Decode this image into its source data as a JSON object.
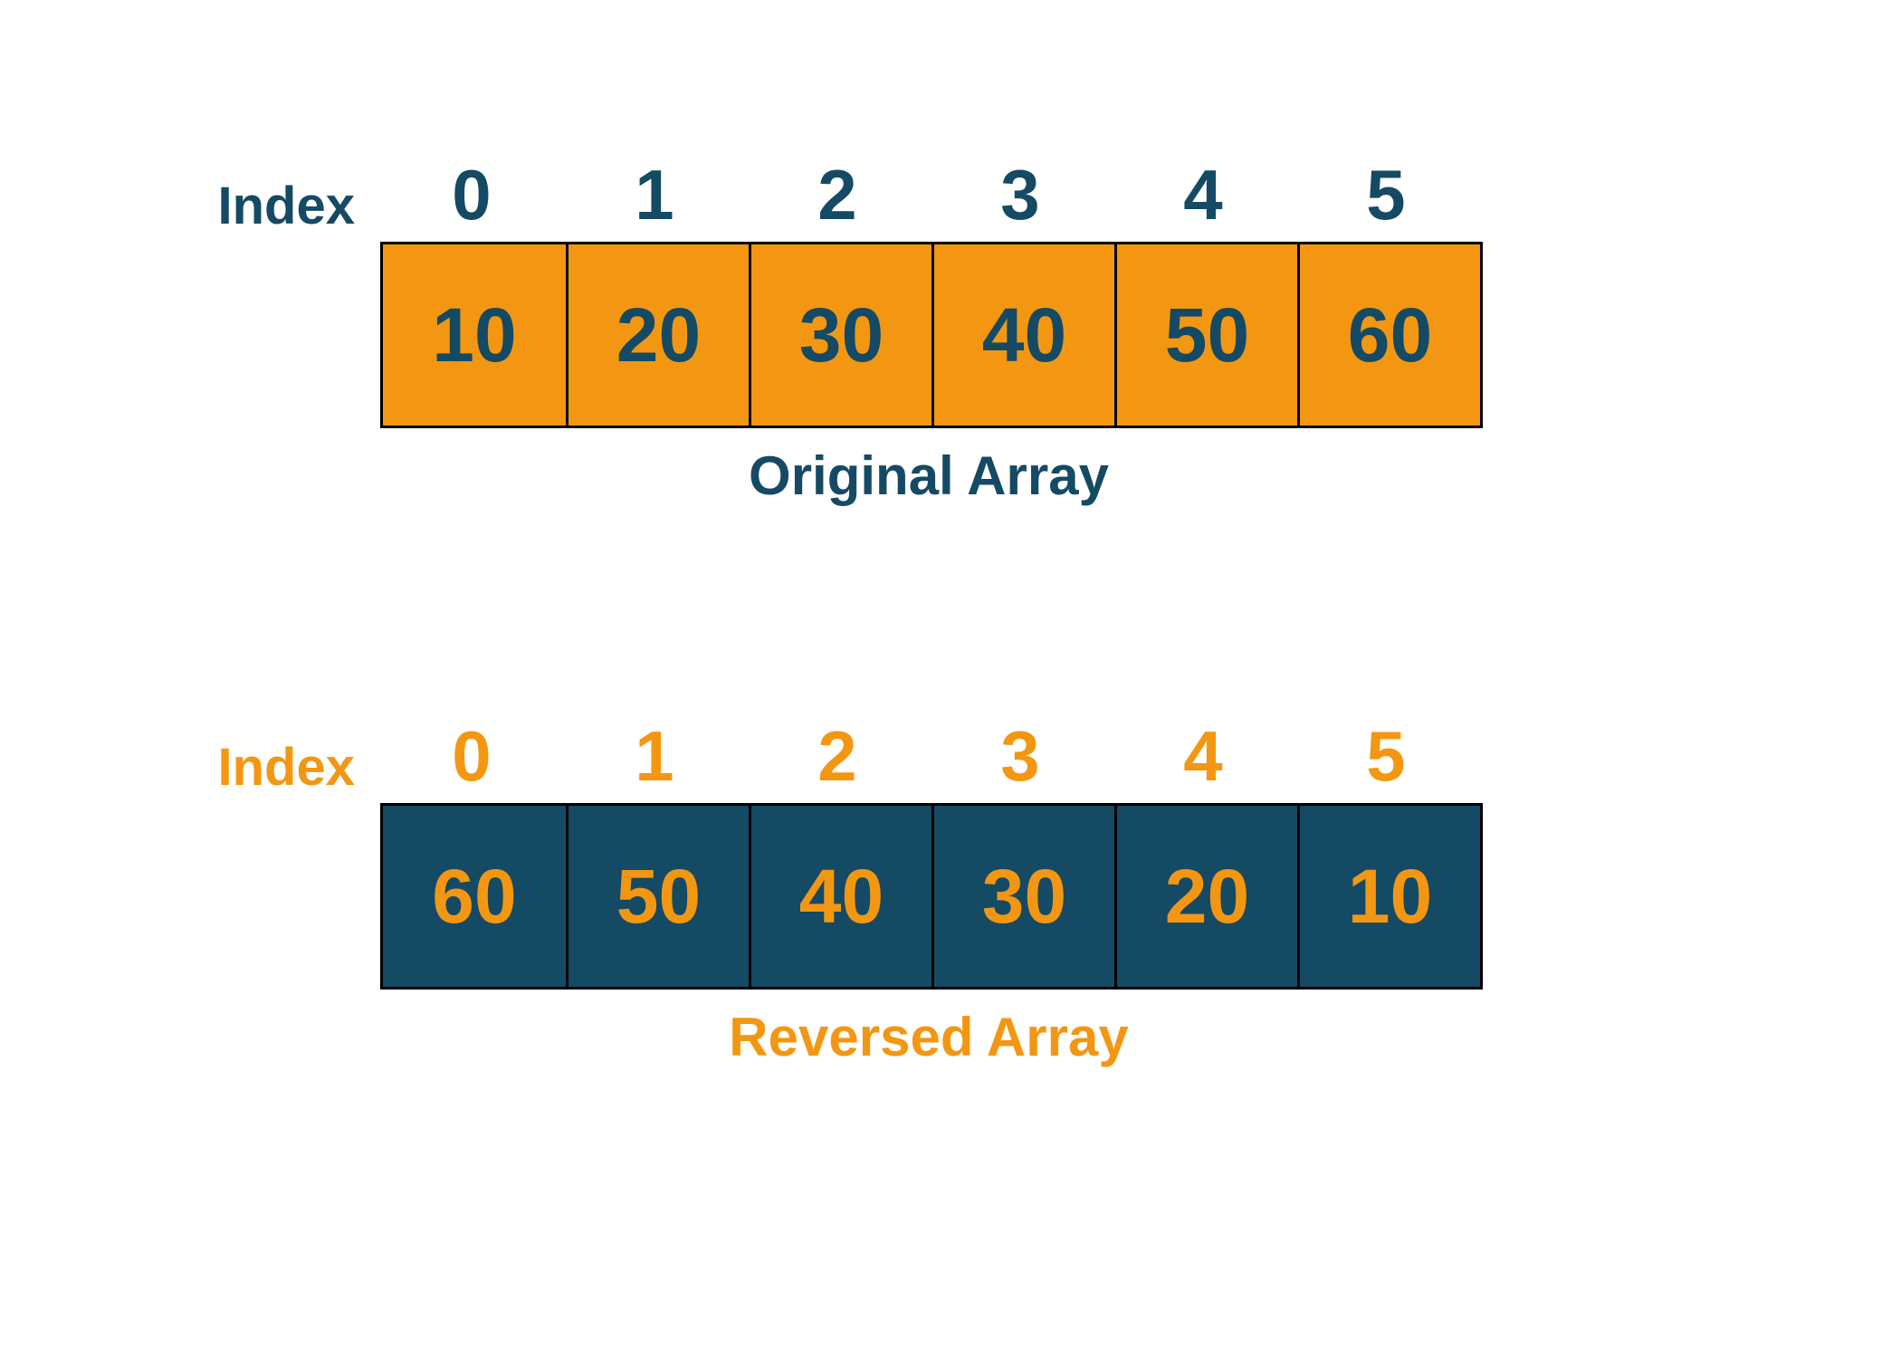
{
  "original": {
    "index_label": "Index",
    "indices": [
      "0",
      "1",
      "2",
      "3",
      "4",
      "5"
    ],
    "values": [
      "10",
      "20",
      "30",
      "40",
      "50",
      "60"
    ],
    "caption": "Original Array"
  },
  "reversed": {
    "index_label": "Index",
    "indices": [
      "0",
      "1",
      "2",
      "3",
      "4",
      "5"
    ],
    "values": [
      "60",
      "50",
      "40",
      "30",
      "20",
      "10"
    ],
    "caption": "Reversed Array"
  },
  "colors": {
    "navy": "#154a64",
    "orange": "#f39712"
  }
}
